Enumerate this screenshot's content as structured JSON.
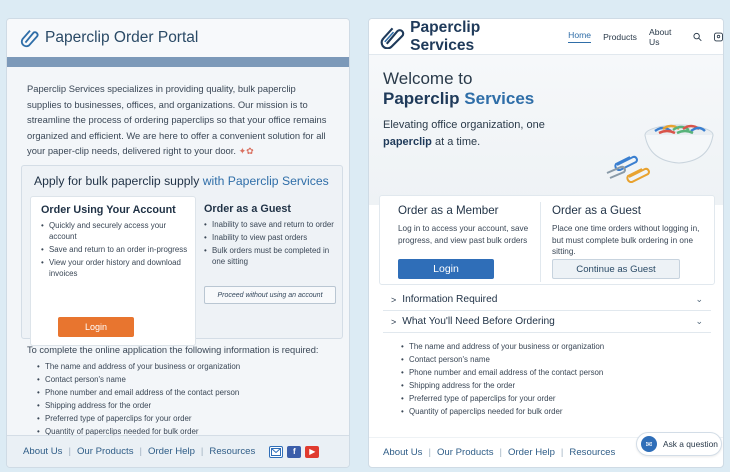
{
  "left": {
    "title": "Paperclip Order Portal",
    "intro": "Paperclip Services specializes in providing quality, bulk paperclip supplies to businesses, offices, and organizations. Our mission is to streamline the process of ordering paperclips so that your office remains organized and efficient. We are here to offer a convenient solution for all your paper-clip needs, delivered right to your door.",
    "apply": {
      "title_main": "Apply for bulk paperclip supply",
      "title_accent": "with Paperclip Services"
    },
    "account": {
      "heading": "Order Using Your Account",
      "bullets": [
        "Quickly and securely access your account",
        "Save and return to an order in-progress",
        "View your order history and download invoices"
      ],
      "button": "Login"
    },
    "guest": {
      "heading": "Order as a Guest",
      "bullets": [
        "Inability to save and return to order",
        "Inability to view past orders",
        "Bulk orders must be completed in one sitting"
      ],
      "button": "Proceed without using an account"
    },
    "requirements_intro": "To complete the online application the following information is required:",
    "requirements": [
      "The name and address of your business or organization",
      "Contact person's name",
      "Phone number and email address of the contact person",
      "Shipping address for the order",
      "Preferred type of paperclips for your order",
      "Quantity of paperclips needed for bulk order"
    ],
    "footer": [
      "About Us",
      "Our Products",
      "Order Help",
      "Resources"
    ]
  },
  "right": {
    "brand": "Paperclip Services",
    "nav": [
      "Home",
      "Products",
      "About Us"
    ],
    "hero": {
      "welcome": "Welcome to",
      "brand_word1": "Paperclip",
      "brand_word2": "Services",
      "tag_pre": "Elevating office organization, one",
      "tag_bold": "paperclip",
      "tag_post": "at a time."
    },
    "member": {
      "heading": "Order as a Member",
      "text": "Log in to access your account, save progress, and view past bulk orders",
      "button": "Login"
    },
    "guest": {
      "heading": "Order as a Guest",
      "text": "Place one time orders without logging in, but must complete bulk ordering in one sitting.",
      "button": "Continue as Guest"
    },
    "accordion": [
      "Information Required",
      "What You'll Need Before Ordering"
    ],
    "requirements": [
      "The name and address of your business or organization",
      "Contact person's name",
      "Phone number and email address of the contact person",
      "Shipping address for the order",
      "Preferred type of paperclips for your order",
      "Quantity of paperclips needed for bulk order"
    ],
    "footer": [
      "About Us",
      "Our Products",
      "Order Help",
      "Resources"
    ],
    "chat": "Ask a question"
  },
  "colors": {
    "accent_blue": "#2f6ea8",
    "orange": "#e8752f",
    "band": "#7c99b9"
  }
}
